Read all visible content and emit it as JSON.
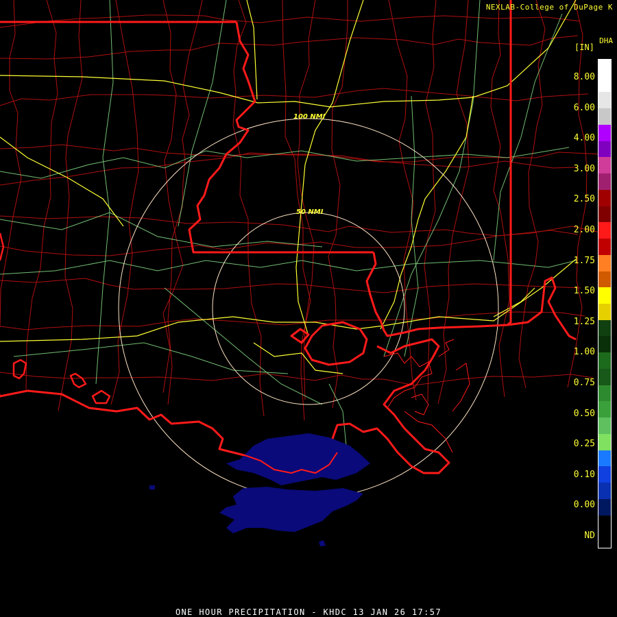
{
  "credit": "NEXLAB-College of DuPage K",
  "product_code": "DHA",
  "unit_label": "[IN]",
  "footer_title": "ONE HOUR PRECIPITATION - KHDC 13 JAN 26 17:57",
  "range_rings": {
    "outer": "100 NMI",
    "inner": "50 NMI"
  },
  "legend": {
    "ticks": [
      "8.00",
      "6.00",
      "4.00",
      "3.00",
      "2.50",
      "2.00",
      "1.75",
      "1.50",
      "1.25",
      "1.00",
      "0.75",
      "0.50",
      "0.25",
      "0.10",
      "0.00",
      "ND"
    ],
    "colors": [
      "#ffffff",
      "#ffffff",
      "#e6e6e6",
      "#c8c8c8",
      "#b000ff",
      "#8000c0",
      "#d03c9a",
      "#a02070",
      "#a00000",
      "#800000",
      "#ff1a1a",
      "#c00000",
      "#ff7f22",
      "#d05a00",
      "#ffff00",
      "#e6d000",
      "#104010",
      "#0a300a",
      "#1c6a1c",
      "#185818",
      "#2e8a2e",
      "#3aa03a",
      "#5ec05e",
      "#80e060",
      "#1a7aff",
      "#1040e0",
      "#0830b0",
      "#001860",
      "#000000",
      "#000000"
    ]
  },
  "colors": {
    "state_border": "#ff1a1a",
    "county_border": "#b01010",
    "interstate": "#ffff33",
    "highway": "#90ee90",
    "range_ring": "#ffe4c4",
    "precip_trace": "#0a0a7a",
    "background": "#000000"
  }
}
